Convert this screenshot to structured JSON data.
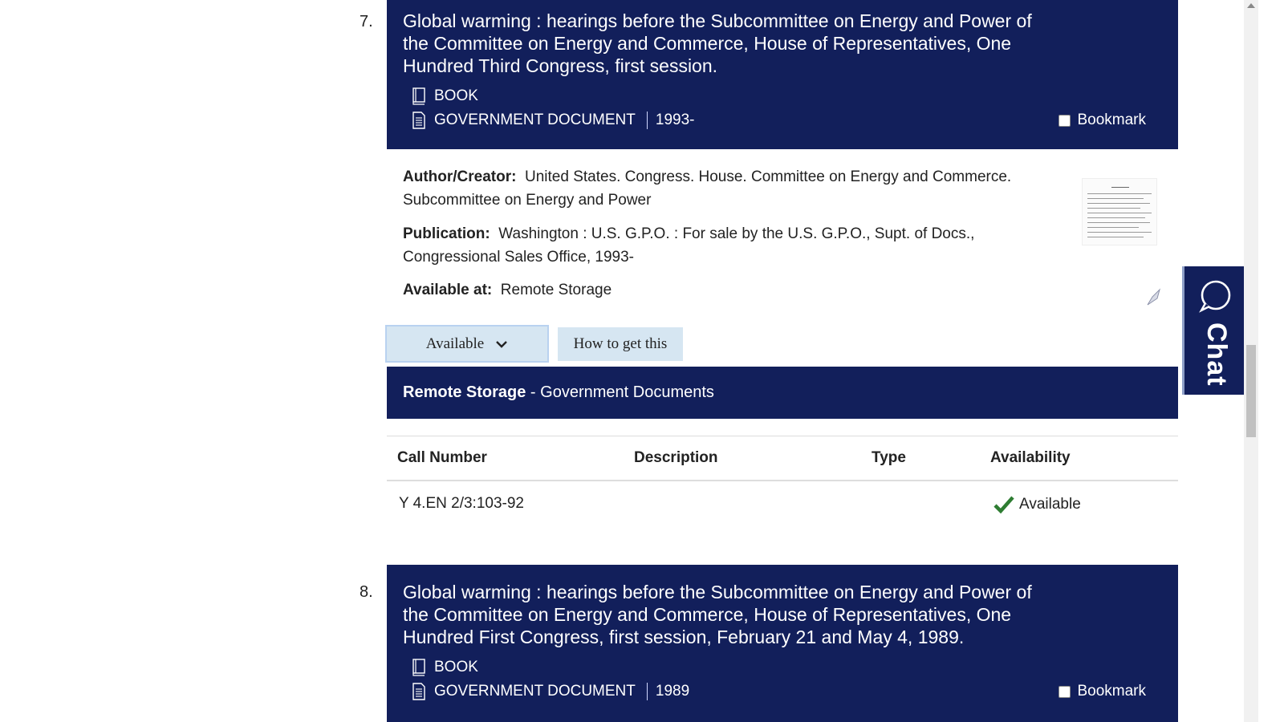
{
  "records": [
    {
      "number": "7.",
      "title": "Global warming : hearings before the Subcommittee on Energy and Power of the Committee on Energy and Commerce, House of Representatives, One Hundred Third Congress, first session.",
      "format_primary": "BOOK",
      "format_secondary": "GOVERNMENT DOCUMENT",
      "year": "1993-",
      "bookmark_label": "Bookmark",
      "author_label": "Author/Creator:",
      "author_value": "United States. Congress. House. Committee on Energy and Commerce. Subcommittee on Energy and Power",
      "publication_label": "Publication:",
      "publication_value": "Washington : U.S. G.P.O. : For sale by the U.S. G.P.O., Supt. of Docs., Congressional Sales Office, 1993-",
      "available_at_label": "Available at:",
      "available_at_value": "Remote Storage",
      "available_button": "Available",
      "how_button": "How to get this",
      "location_name": "Remote Storage",
      "location_collection": " - Government Documents",
      "table": {
        "headers": [
          "Call Number",
          "Description",
          "Type",
          "Availability"
        ],
        "rows": [
          {
            "call_number": "Y 4.EN 2/3:103-92",
            "description": "",
            "type": "",
            "availability": "Available"
          }
        ]
      }
    },
    {
      "number": "8.",
      "title": "Global warming : hearings before the Subcommittee on Energy and Power of the Committee on Energy and Commerce, House of Representatives, One Hundred First Congress, first session, February 21 and May 4, 1989.",
      "format_primary": "BOOK",
      "format_secondary": "GOVERNMENT DOCUMENT",
      "year": "1989",
      "bookmark_label": "Bookmark"
    }
  ],
  "chat_label": "Chat",
  "colors": {
    "header_bg": "#121f5b",
    "button_bg": "#d6e6f2",
    "check_green": "#2e7d32"
  }
}
